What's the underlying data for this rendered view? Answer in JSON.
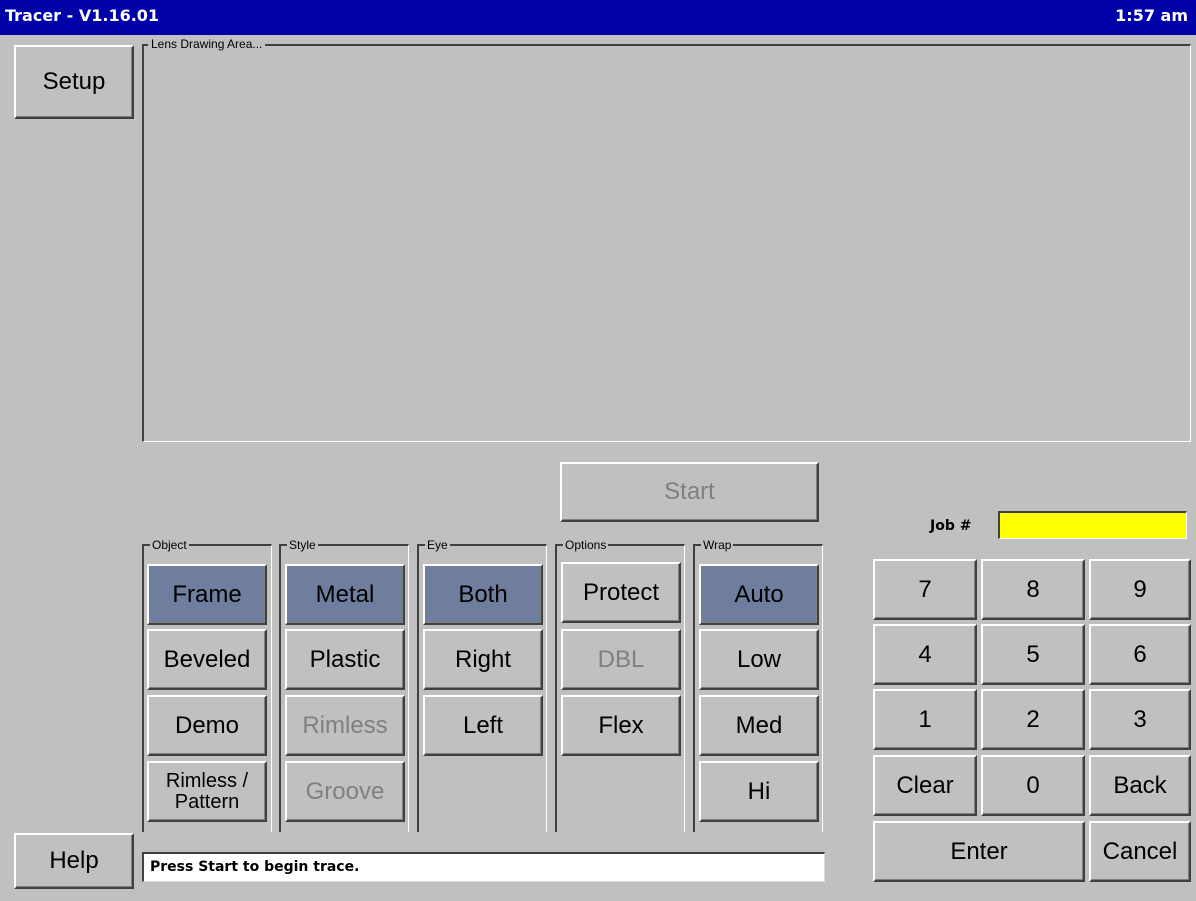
{
  "window": {
    "title": "Tracer - V1.16.01",
    "clock": "1:57 am"
  },
  "buttons": {
    "setup": "Setup",
    "help": "Help",
    "start": "Start"
  },
  "drawing_area": {
    "label": "Lens Drawing Area..."
  },
  "groups": {
    "object": {
      "label": "Object",
      "items": [
        "Frame",
        "Beveled",
        "Demo",
        "Rimless / Pattern"
      ]
    },
    "style": {
      "label": "Style",
      "items": [
        "Metal",
        "Plastic",
        "Rimless",
        "Groove"
      ]
    },
    "eye": {
      "label": "Eye",
      "items": [
        "Both",
        "Right",
        "Left"
      ]
    },
    "options": {
      "label": "Options",
      "items": [
        "Protect",
        "DBL",
        "Flex"
      ]
    },
    "wrap": {
      "label": "Wrap",
      "items": [
        "Auto",
        "Low",
        "Med",
        "Hi"
      ]
    }
  },
  "selected": {
    "object": "Frame",
    "style": "Metal",
    "eye": "Both",
    "wrap": "Auto"
  },
  "disabled": [
    "Start",
    "Rimless",
    "Groove",
    "DBL"
  ],
  "job": {
    "label": "Job #",
    "value": ""
  },
  "keypad": {
    "k7": "7",
    "k8": "8",
    "k9": "9",
    "k4": "4",
    "k5": "5",
    "k6": "6",
    "k1": "1",
    "k2": "2",
    "k3": "3",
    "clear": "Clear",
    "k0": "0",
    "back": "Back",
    "enter": "Enter",
    "cancel": "Cancel"
  },
  "status": {
    "message": "Press Start to begin trace."
  },
  "colors": {
    "titlebar": "#0000a8",
    "selected": "#6f7e9e",
    "job_field": "#ffff00",
    "face": "#c0c0c0"
  }
}
